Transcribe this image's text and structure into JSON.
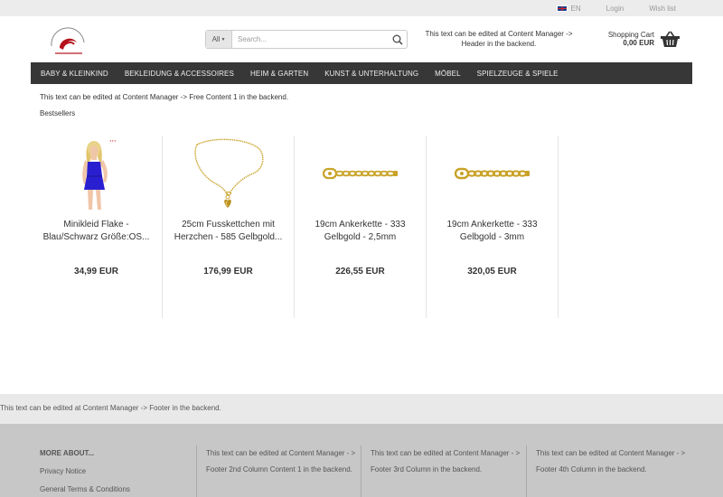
{
  "topbar": {
    "language": "EN",
    "login": "Login",
    "wishlist": "Wish list"
  },
  "search": {
    "category": "All",
    "placeholder": "Search..."
  },
  "header_text": "This text can be edited at Content Manager -> Header in the backend.",
  "cart": {
    "label": "Shopping Cart",
    "amount": "0,00 EUR"
  },
  "nav": [
    "BABY & KLEINKIND",
    "BEKLEIDUNG & ACCESSOIRES",
    "HEIM & GARTEN",
    "KUNST & UNTERHALTUNG",
    "MÖBEL",
    "SPIELZEUGE & SPIELE"
  ],
  "content1": "This text can be edited at Content Manager -> Free Content 1 in the backend.",
  "bestsellers_label": "Bestsellers",
  "products": [
    {
      "name": "Minikleid Flake - Blau/Schwarz Größe:OS...",
      "price": "34,99 EUR",
      "image": "blue-dress-model"
    },
    {
      "name": "25cm Fusskettchen mit Herzchen - 585 Gelbgold...",
      "price": "176,99 EUR",
      "image": "gold-anklet-heart"
    },
    {
      "name": "19cm Ankerkette - 333 Gelbgold - 2,5mm",
      "price": "226,55 EUR",
      "image": "gold-anchor-chain"
    },
    {
      "name": "19cm Ankerkette - 333 Gelbgold - 3mm",
      "price": "320,05 EUR",
      "image": "gold-anchor-chain"
    }
  ],
  "footer_note": "This text can be edited at Content Manager -> Footer in the backend.",
  "footer": {
    "more_about": "MORE ABOUT...",
    "links": [
      "Privacy Notice",
      "General Terms & Conditions"
    ],
    "col2": "This text can be edited at Content Manager - > Footer 2nd Column Content 1 in the backend.",
    "col3": "This text can be edited at Content Manager - > Footer 3rd Column in the backend.",
    "col4": "This text can be edited at Content Manager - > Footer 4th Column in the backend."
  },
  "colors": {
    "navbar": "#373737",
    "logo_red": "#b5121b",
    "gold": "#c9a227",
    "dress_blue": "#2a1fd0"
  }
}
